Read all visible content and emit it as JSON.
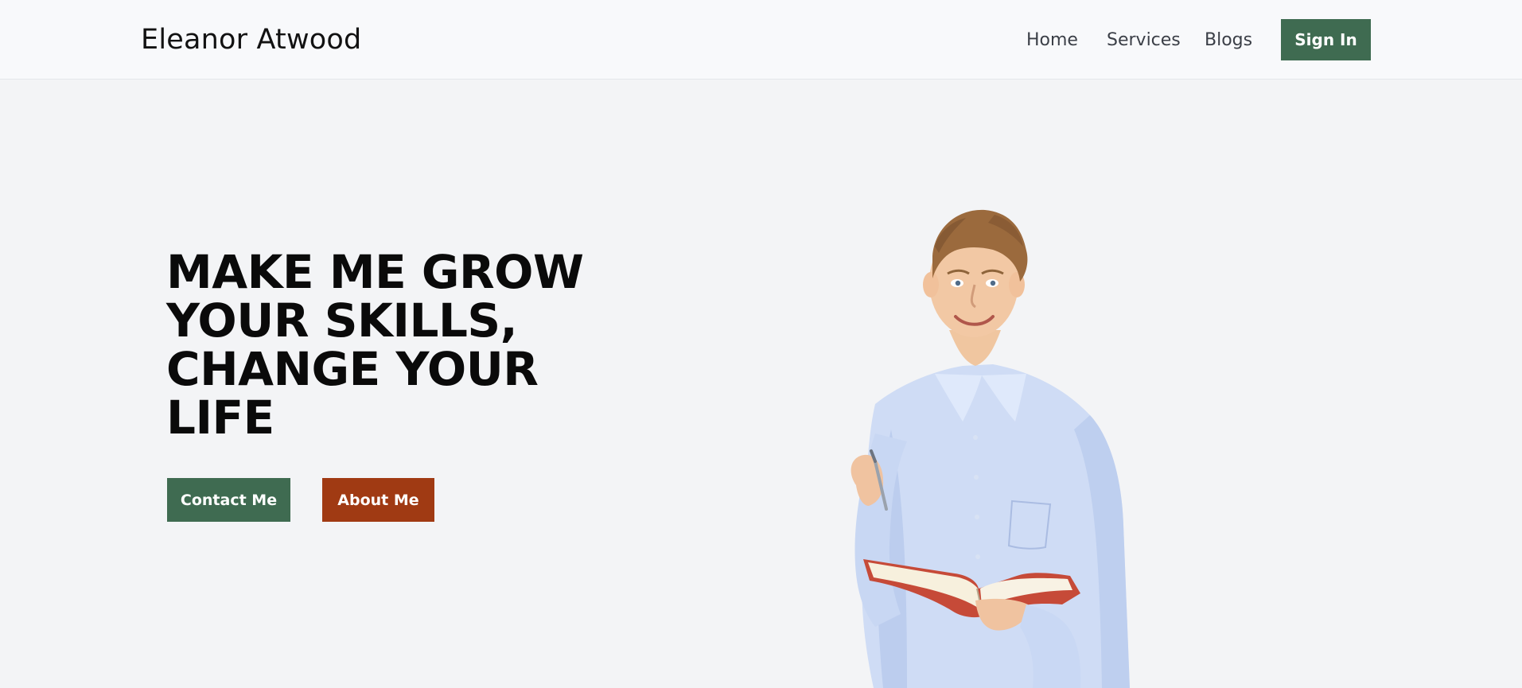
{
  "brand": {
    "name": "Eleanor Atwood"
  },
  "nav": {
    "items": [
      "Home",
      "Services",
      "Blogs"
    ],
    "signin_label": "Sign In"
  },
  "hero": {
    "title": "MAKE ME GROW YOUR SKILLS, CHANGE YOUR LIFE",
    "contact_label": "Contact Me",
    "about_label": "About Me"
  },
  "colors": {
    "primary": "#3f6b51",
    "secondary": "#a03a13",
    "background": "#f3f4f6",
    "header": "#f8f9fb"
  },
  "image": {
    "subject": "smiling man holding a red book and a pen"
  }
}
